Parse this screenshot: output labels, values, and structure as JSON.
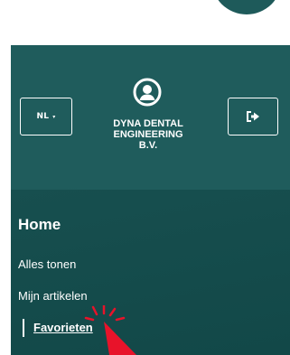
{
  "colors": {
    "header_bg": "#1f5c5c",
    "menu_bg": "#154c4c",
    "text": "#ffffff",
    "cursor": "#e8132a"
  },
  "header": {
    "language_label": "NL",
    "language_caret_icon": "chevron-down-icon",
    "company_name": "DYNA DENTAL\nENGINEERING\nB.V.",
    "avatar_icon": "user-circle-icon",
    "logout_icon": "logout-icon"
  },
  "menu": {
    "title": "Home",
    "items": [
      {
        "label": "Alles tonen"
      },
      {
        "label": "Mijn artikelen"
      },
      {
        "label": "Favorieten",
        "active": true
      }
    ]
  },
  "cursor": {
    "icon": "pointer-arrow-icon"
  }
}
